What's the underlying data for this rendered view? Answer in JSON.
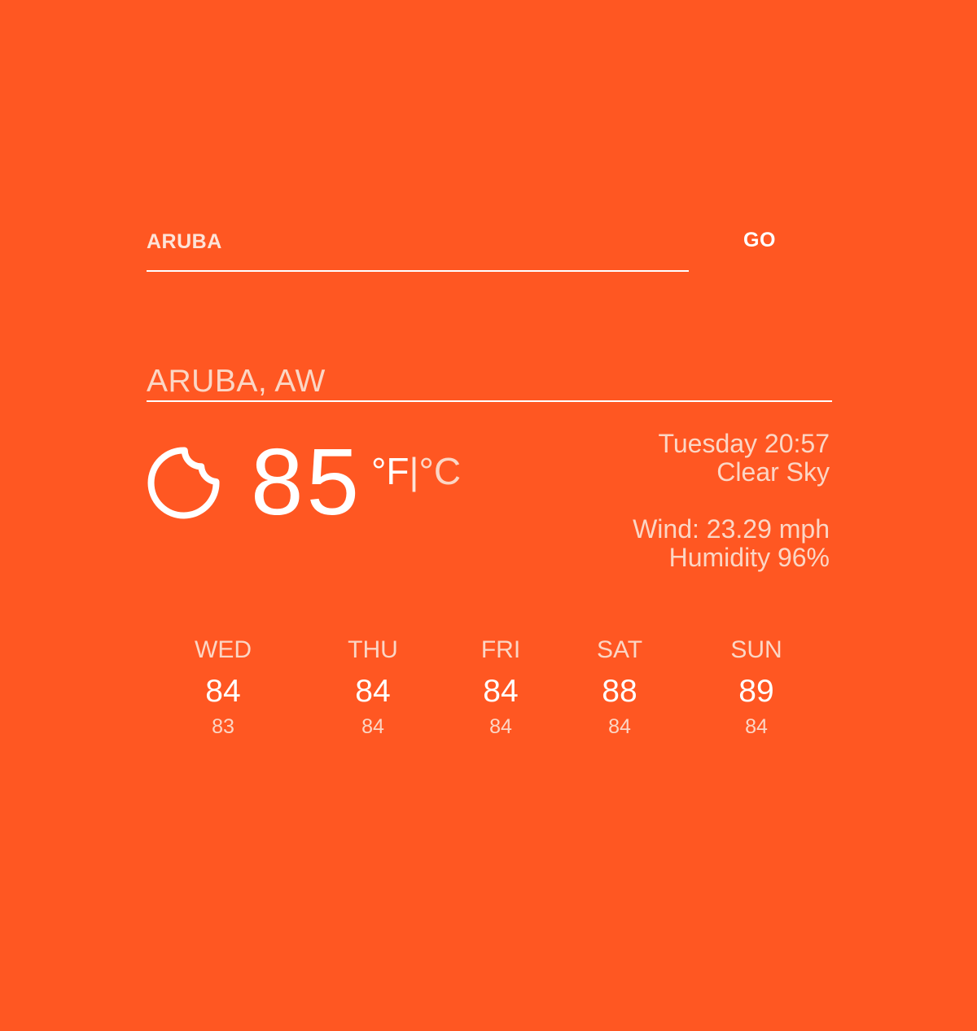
{
  "search": {
    "value": "ARUBA",
    "go_label": "GO"
  },
  "location": {
    "title": "ARUBA, AW"
  },
  "current": {
    "icon": "moon-icon",
    "temperature": "85",
    "unit_f": "°F",
    "unit_separator": "|",
    "unit_c": "°C",
    "datetime": "Tuesday 20:57",
    "condition": "Clear Sky",
    "wind": "Wind: 23.29 mph",
    "humidity": "Humidity 96%"
  },
  "forecast": [
    {
      "day": "WED",
      "high": "84",
      "low": "83"
    },
    {
      "day": "THU",
      "high": "84",
      "low": "84"
    },
    {
      "day": "FRI",
      "high": "84",
      "low": "84"
    },
    {
      "day": "SAT",
      "high": "88",
      "low": "84"
    },
    {
      "day": "SUN",
      "high": "89",
      "low": "84"
    }
  ],
  "colors": {
    "background": "#ff5722",
    "foreground": "#ffffff",
    "muted": "#fbd6c5"
  }
}
